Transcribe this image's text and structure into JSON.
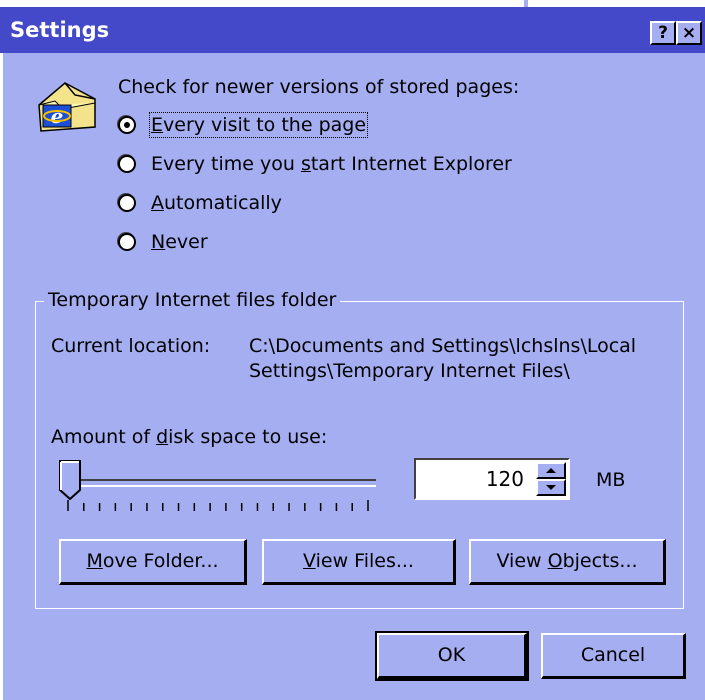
{
  "dialog": {
    "title": "Settings",
    "help_button": "?",
    "close_button": "×"
  },
  "check_section": {
    "heading": "Check for newer versions of stored pages:",
    "options": [
      {
        "pre": "",
        "key": "E",
        "post": "very visit to the page",
        "checked": true
      },
      {
        "pre": "Every time you ",
        "key": "s",
        "post": "tart Internet Explorer",
        "checked": false
      },
      {
        "pre": "",
        "key": "A",
        "post": "utomatically",
        "checked": false
      },
      {
        "pre": "",
        "key": "N",
        "post": "ever",
        "checked": false
      }
    ]
  },
  "temp_folder": {
    "legend": "Temporary Internet files folder",
    "current_location_label": "Current location:",
    "current_location_line1": "C:\\Documents and Settings\\lchslns\\Local",
    "current_location_line2": "Settings\\Temporary Internet Files\\",
    "disk_label_pre": "Amount of ",
    "disk_label_key": "d",
    "disk_label_post": "isk space to use:",
    "slider_fraction": 0.0,
    "disk_value": "120",
    "unit": "MB"
  },
  "buttons": {
    "move_folder": {
      "pre": "",
      "key": "M",
      "post": "ove Folder..."
    },
    "view_files": {
      "pre": "",
      "key": "V",
      "post": "iew Files..."
    },
    "view_objects": {
      "pre": "View ",
      "key": "O",
      "post": "bjects..."
    },
    "ok": "OK",
    "cancel": "Cancel"
  },
  "colors": {
    "titlebar": "#4349c9",
    "dialog_bg": "#a4aef1"
  },
  "icons": {
    "folder": "ie-folder-icon"
  }
}
